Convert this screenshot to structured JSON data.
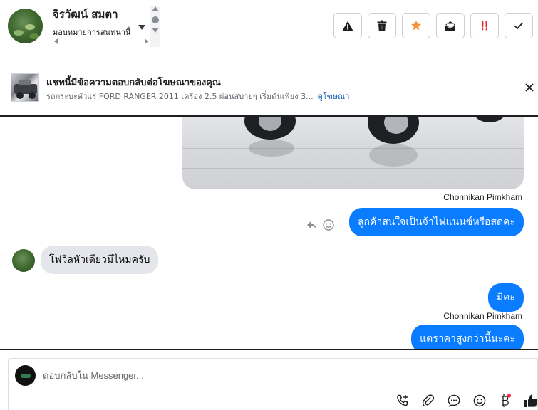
{
  "header": {
    "contact_name": "จิรวัฒน์ สมตา",
    "assign_label": "มอบหมายการสนทนานี้",
    "actions": [
      {
        "id": "spam",
        "icon": "warning-icon"
      },
      {
        "id": "delete",
        "icon": "trash-icon"
      },
      {
        "id": "follow-up",
        "icon": "star-icon",
        "color": "#f7923b"
      },
      {
        "id": "mark-unread",
        "icon": "envelope-open-icon"
      },
      {
        "id": "priority",
        "icon": "priority-icon",
        "color": "#e02a2a"
      },
      {
        "id": "done",
        "icon": "check-icon"
      }
    ]
  },
  "ad": {
    "title": "แชทนี้มีข้อความตอบกลับต่อโฆษณาของคุณ",
    "description": "รถกระบะตัวแร่ FORD RANGER 2011 เครื่อง 2.5 ผ่อนสบายๆ เริ่มต้นเพียง 3...",
    "link_label": "ดูโฆษณา"
  },
  "messages": {
    "sender_1": "Chonnikan Pimkham",
    "out_1": "ลูกค้าสนใจเป็นจ้าไฟแนนซ์หรือสดคะ",
    "in_1": "โฟวิลหัวเดียวมีไหมครับ",
    "out_2": "มีคะ",
    "sender_2": "Chonnikan Pimkham",
    "out_3": "แตราคาสูงกว่านี้นะคะ"
  },
  "composer": {
    "placeholder": "ตอบกลับใน Messenger...",
    "tools": [
      "call-add-icon",
      "attachment-icon",
      "saved-reply-icon",
      "emoji-icon",
      "baht-icon",
      "like-icon"
    ]
  },
  "colors": {
    "accent": "#0a7cff",
    "incoming": "#e4e6eb",
    "link": "#1a5bb6"
  }
}
